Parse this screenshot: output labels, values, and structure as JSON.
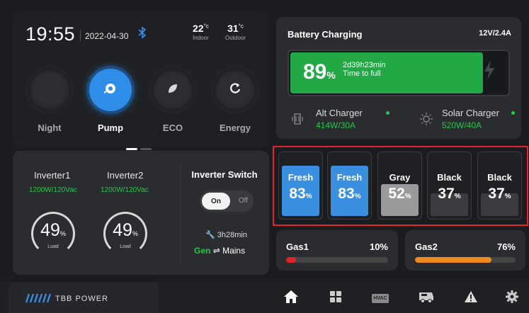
{
  "status": {
    "time": "19:55",
    "date": "2022-04-30",
    "indoor_temp": "22",
    "indoor_unit": "°c",
    "indoor_label": "Indoor",
    "outdoor_temp": "31",
    "outdoor_unit": "°c",
    "outdoor_label": "Outdoor"
  },
  "modes": [
    {
      "label": "Night",
      "icon": "moon-icon",
      "active": false
    },
    {
      "label": "Pump",
      "icon": "pump-icon",
      "active": true
    },
    {
      "label": "ECO",
      "icon": "leaf-icon",
      "active": false
    },
    {
      "label": "Energy",
      "icon": "refresh-icon",
      "active": false
    }
  ],
  "page_indicator": {
    "pages": 2,
    "current": 1
  },
  "battery": {
    "title": "Battery Charging",
    "spec": "12V/2.4A",
    "percent": "89",
    "percent_unit": "%",
    "level": 0.89,
    "time_value": "2d39h23min",
    "time_label": "Time to full",
    "alt_charger": {
      "name": "Alt Charger",
      "value": "414W/30A"
    },
    "solar_charger": {
      "name": "Solar Charger",
      "value": "520W/40A"
    }
  },
  "inverter": {
    "inv1": {
      "name": "Inverter1",
      "value": "1200W/120Vac",
      "load": "49",
      "unit": "%",
      "load_label": "Load"
    },
    "inv2": {
      "name": "Inverter2",
      "value": "1200W/120Vac",
      "load": "49",
      "unit": "%",
      "load_label": "Load"
    },
    "switch_title": "Inverter Switch",
    "toggle_on": "On",
    "toggle_off": "Off",
    "timer": "3h28min",
    "gen": "Gen",
    "arrow": "⇌",
    "mains": "Mains"
  },
  "tanks": [
    {
      "name": "Fresh",
      "value": "83",
      "unit": "%",
      "level": 0.83,
      "color": "#3b8fe0"
    },
    {
      "name": "Fresh",
      "value": "83",
      "unit": "%",
      "level": 0.83,
      "color": "#3b8fe0"
    },
    {
      "name": "Gray",
      "value": "52",
      "unit": "%",
      "level": 0.52,
      "color": "#9a9a9a"
    },
    {
      "name": "Black",
      "value": "37",
      "unit": "%",
      "level": 0.37,
      "color": "#3b3c40"
    },
    {
      "name": "Black",
      "value": "37",
      "unit": "%",
      "level": 0.37,
      "color": "#3b3c40"
    }
  ],
  "gas": [
    {
      "name": "Gas1",
      "value": "10%",
      "level": 0.1,
      "color": "#e0242a"
    },
    {
      "name": "Gas2",
      "value": "76%",
      "level": 0.76,
      "color": "#f08a1c"
    }
  ],
  "nav": {
    "brand": "TBB POWER",
    "items": [
      {
        "icon": "home-icon",
        "active": true
      },
      {
        "icon": "grid-icon",
        "active": false
      },
      {
        "icon": "hvac-icon",
        "label": "HVAC",
        "active": false
      },
      {
        "icon": "rv-icon",
        "active": false
      },
      {
        "icon": "warning-icon",
        "active": false
      },
      {
        "icon": "gear-icon",
        "active": false
      }
    ]
  }
}
